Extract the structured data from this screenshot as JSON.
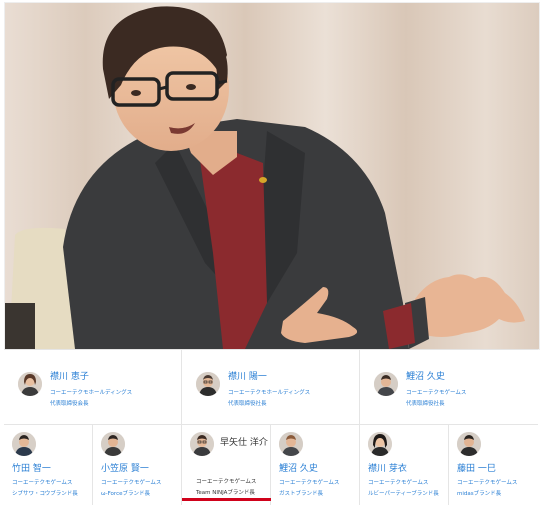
{
  "hero": {
    "subject": "interview-photo"
  },
  "members_top": [
    {
      "name": "襟川 恵子",
      "company": "コーエーテクモホールディングス",
      "role": "代表取締役会長",
      "icon": "avatar-woman"
    },
    {
      "name": "襟川 陽一",
      "company": "コーエーテクモホールディングス",
      "role": "代表取締役社長",
      "icon": "avatar-man-glasses"
    },
    {
      "name": "鯉沼 久史",
      "company": "コーエーテクモゲームス",
      "role": "代表取締役社長",
      "icon": "avatar-man"
    }
  ],
  "members_bottom": [
    {
      "name": "竹田 智一",
      "company": "コーエーテクモゲームス",
      "role": "シブサワ・コウブランド長",
      "icon": "avatar-man"
    },
    {
      "name": "小笠原 賢一",
      "company": "コーエーテクモゲームス",
      "role": "ω-Forceブランド長",
      "icon": "avatar-man"
    },
    {
      "name": "早矢仕 洋介",
      "company": "コーエーテクモゲームス",
      "role": "Team NINJAブランド長",
      "icon": "avatar-man",
      "active": true
    },
    {
      "name": "鯉沼 久史",
      "company": "コーエーテクモゲームス",
      "role": "ガストブランド長",
      "icon": "avatar-man"
    },
    {
      "name": "襟川 芽衣",
      "company": "コーエーテクモゲームス",
      "role": "ルビーパーティーブランド長",
      "icon": "avatar-woman"
    },
    {
      "name": "藤田 一巳",
      "company": "コーエーテクモゲームス",
      "role": "midasブランド長",
      "icon": "avatar-man"
    }
  ],
  "colors": {
    "link": "#2a7fd4",
    "active_name": "#333333",
    "active_underline": "#d0021b"
  }
}
